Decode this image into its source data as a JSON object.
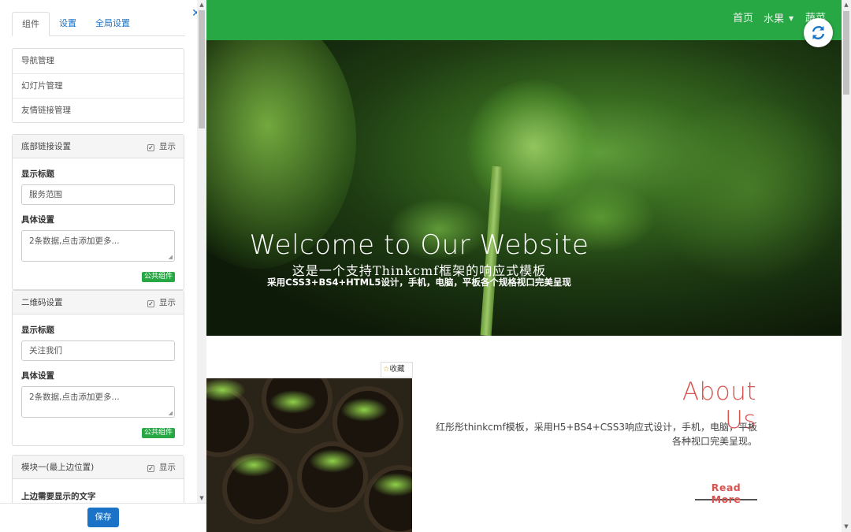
{
  "panel": {
    "tabs": [
      {
        "label": "组件",
        "active": true
      },
      {
        "label": "设置",
        "active": false
      },
      {
        "label": "全局设置",
        "active": false
      }
    ],
    "close_icon": "close-icon",
    "nav_list": [
      {
        "label": "导航管理"
      },
      {
        "label": "幻灯片管理"
      },
      {
        "label": "友情链接管理"
      }
    ],
    "cards": [
      {
        "title": "底部链接设置",
        "show_label": "显示",
        "show_checked": true,
        "field_title_label": "显示标题",
        "field_title_value": "服务范围",
        "field_detail_label": "具体设置",
        "field_detail_value": "2条数据,点击添加更多...",
        "badge": "公共组件"
      },
      {
        "title": "二维码设置",
        "show_label": "显示",
        "show_checked": true,
        "field_title_label": "显示标题",
        "field_title_value": "关注我们",
        "field_detail_label": "具体设置",
        "field_detail_value": "2条数据,点击添加更多...",
        "badge": "公共组件"
      },
      {
        "title": "模块一(最上边位置)",
        "show_label": "显示",
        "show_checked": true,
        "field_title_label": "上边需要显示的文字"
      }
    ],
    "save_label": "保存"
  },
  "site": {
    "nav": [
      {
        "label": "首页"
      },
      {
        "label": "水果"
      },
      {
        "label": "蔬菜"
      }
    ],
    "refresh_icon": "refresh-icon",
    "banner": {
      "title": "Welcome to Our Website",
      "subtitle": "这是一个支持Thinkcmf框架的响应式模板",
      "caption": "采用CSS3+BS4+HTML5设计，手机，电脑，平板各个规格视口完美呈现"
    },
    "favorite_label": "收藏",
    "about": {
      "title": "About Us",
      "text": "红彤彤thinkcmf模板，采用H5+BS4+CSS3响应式设计，手机，电脑，平板各种视口完美呈现。",
      "read_more": "Read More"
    }
  },
  "colors": {
    "navbar": "#28a745",
    "accent": "#1a73c7",
    "about_title": "#d9534f",
    "badge": "#28a745"
  }
}
